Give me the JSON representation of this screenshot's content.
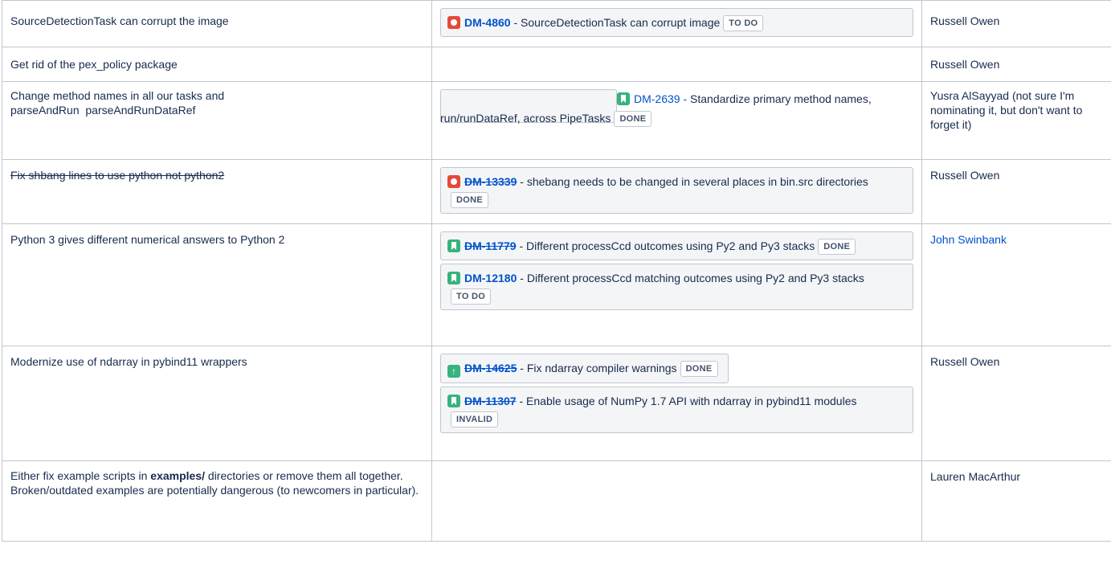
{
  "rows": [
    {
      "description": "SourceDetectionTask can corrupt the image",
      "issues": [
        {
          "key": "DM-4860",
          "summary": "SourceDetectionTask can corrupt image",
          "status": "TO DO",
          "icon": "bug-icon"
        }
      ],
      "person": "Russell Owen"
    },
    {
      "description": "Get rid of the pex_policy package",
      "issues": [],
      "person": "Russell Owen"
    },
    {
      "description_lines": [
        "Change method names in all our tasks and",
        "parseAndRun  parseAndRunDataRef"
      ],
      "issues": [
        {
          "key": "DM-2639",
          "summary": "Standardize primary method names, run/runDataRef, across PipeTasks",
          "status": "DONE",
          "icon": "story-icon"
        }
      ],
      "person": "Yusra AlSayyad (not sure I'm nominating it, but don't want to forget it)"
    },
    {
      "description": "Fix shbang lines to use python not python2",
      "issues": [
        {
          "key": "DM-13339",
          "summary": "shebang needs to be changed in several places in bin.src directories",
          "status": "DONE",
          "icon": "bug-icon"
        }
      ],
      "person": "Russell Owen"
    },
    {
      "description": "Python 3 gives different numerical answers to Python 2",
      "issues": [
        {
          "key": "DM-11779",
          "summary": "Different processCcd outcomes using Py2 and Py3 stacks",
          "status": "DONE",
          "icon": "story-icon"
        },
        {
          "key": "DM-12180",
          "summary": "Different processCcd matching outcomes using Py2 and Py3 stacks",
          "status": "TO DO",
          "icon": "story-icon"
        }
      ],
      "person": "John Swinbank"
    },
    {
      "description": "Modernize use of ndarray in pybind11 wrappers",
      "issues": [
        {
          "key": "DM-14625",
          "summary": "Fix ndarray compiler warnings",
          "status": "DONE",
          "icon": "improvement-icon"
        },
        {
          "key": "DM-11307",
          "summary": "Enable usage of NumPy 1.7 API with ndarray in pybind11 modules",
          "status": "INVALID",
          "icon": "story-icon"
        }
      ],
      "person": "Russell Owen"
    },
    {
      "description_pre": "Either fix example scripts in ",
      "description_bold": "examples/",
      "description_post": " directories or remove them all together. Broken/outdated examples are potentially dangerous (to newcomers in particular).",
      "issues": [],
      "person": "Lauren MacArthur"
    }
  ],
  "separator": " - ",
  "improvement_glyph": "↑"
}
